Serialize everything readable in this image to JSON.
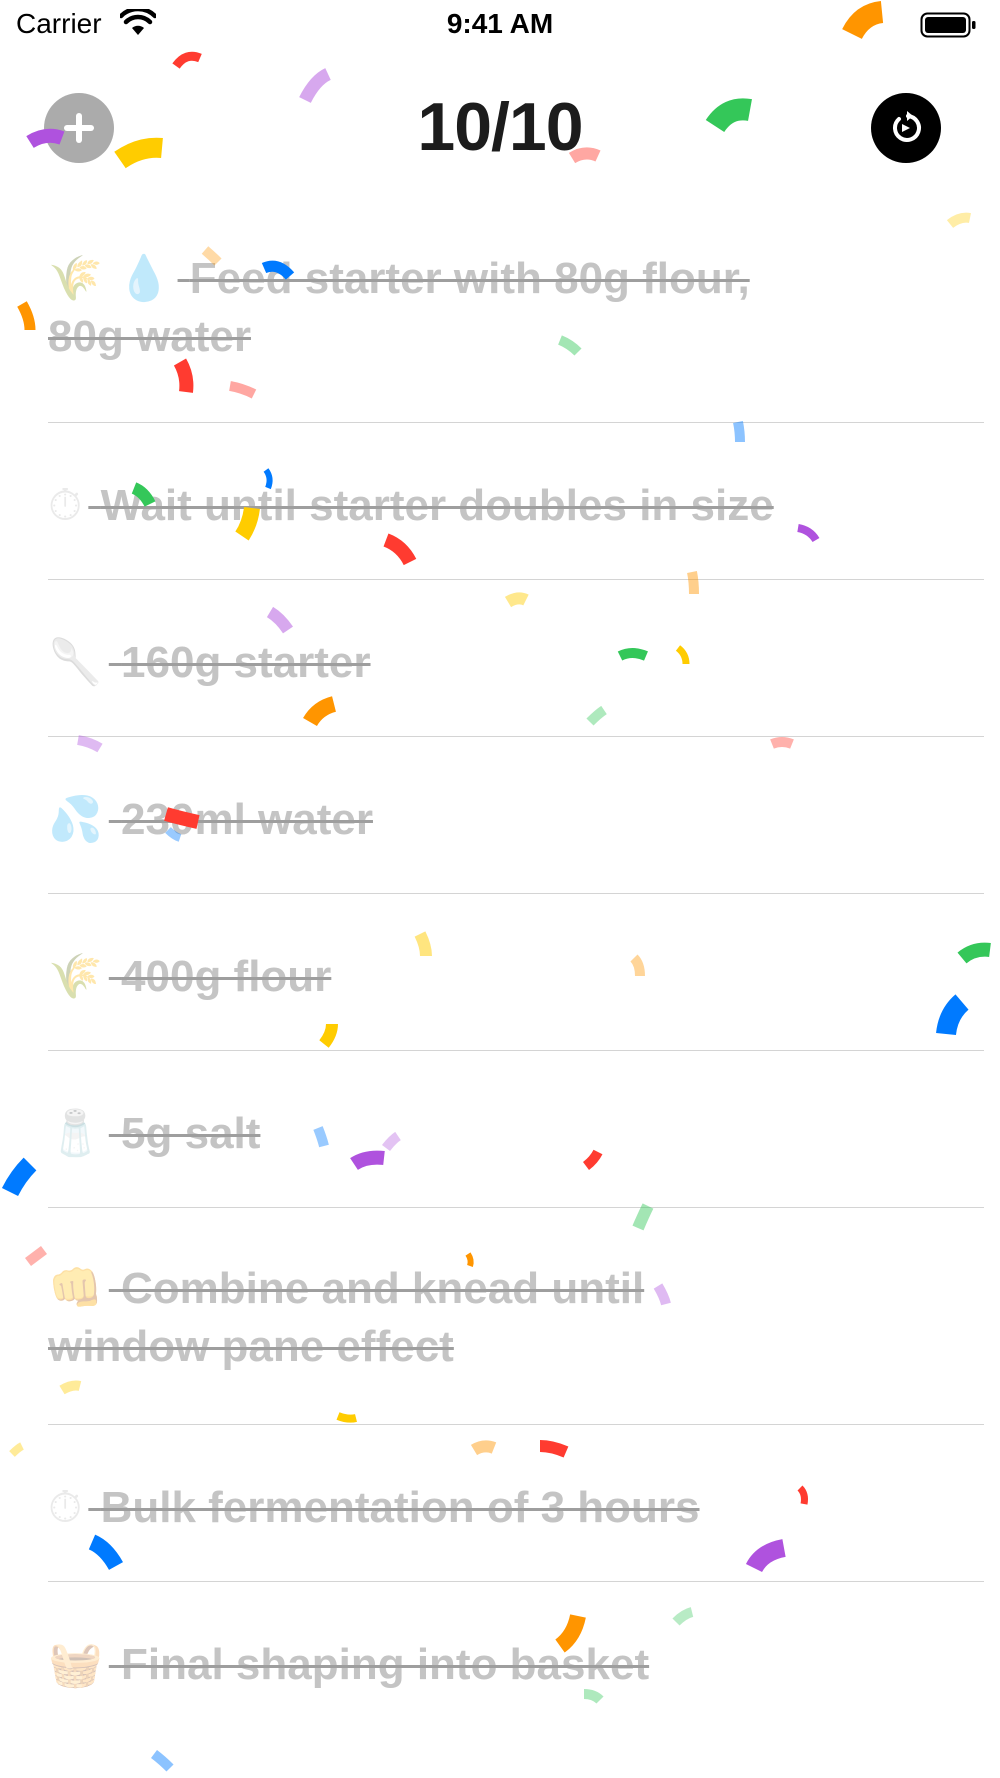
{
  "status_bar": {
    "carrier": "Carrier",
    "time": "9:41 AM"
  },
  "header": {
    "progress": "10/10",
    "add_icon": "plus-icon",
    "reset_icon": "reset-icon"
  },
  "steps": [
    {
      "emoji": "🌾 💧",
      "text": "Feed starter with 80g flour, 80g water"
    },
    {
      "emoji": "⏱",
      "text": "Wait until starter doubles in size"
    },
    {
      "emoji": "🥄",
      "text": "160g starter"
    },
    {
      "emoji": "💦",
      "text": "230ml water"
    },
    {
      "emoji": "🌾",
      "text": "400g flour"
    },
    {
      "emoji": "🧂",
      "text": "5g salt"
    },
    {
      "emoji": "👊",
      "text": "Combine and knead until window pane effect"
    },
    {
      "emoji": "⏱",
      "text": "Bulk fermentation of 3 hours"
    },
    {
      "emoji": "🧺",
      "text": "Final shaping into basket"
    }
  ],
  "colors": {
    "confetti": [
      "#ff3b30",
      "#ff9500",
      "#ffcc00",
      "#34c759",
      "#007aff",
      "#af52de"
    ]
  }
}
